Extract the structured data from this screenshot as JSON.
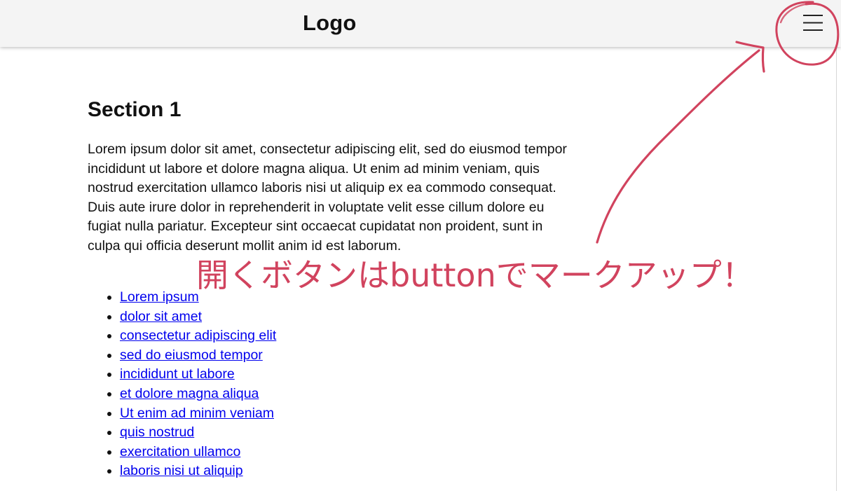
{
  "header": {
    "logo": "Logo",
    "menu_icon": "hamburger-menu-icon"
  },
  "main": {
    "section_title": "Section 1",
    "paragraph": "Lorem ipsum dolor sit amet, consectetur adipiscing elit, sed do eiusmod tempor incididunt ut labore et dolore magna aliqua. Ut enim ad minim veniam, quis nostrud exercitation ullamco laboris nisi ut aliquip ex ea commodo consequat. Duis aute irure dolor in reprehenderit in voluptate velit esse cillum dolore eu fugiat nulla pariatur. Excepteur sint occaecat cupidatat non proident, sunt in culpa qui officia deserunt mollit anim id est laborum.",
    "links": [
      "Lorem ipsum",
      "dolor sit amet",
      "consectetur adipiscing elit",
      "sed do eiusmod tempor",
      "incididunt ut labore",
      "et dolore magna aliqua",
      "Ut enim ad minim veniam",
      "quis nostrud",
      "exercitation ullamco",
      "laboris nisi ut aliquip"
    ]
  },
  "annotation": {
    "text": "開くボタンはbuttonでマークアップ！",
    "color": "#d1435e"
  },
  "colors": {
    "header_bg": "#f4f4f4",
    "link": "#0000ee",
    "text": "#111111"
  }
}
